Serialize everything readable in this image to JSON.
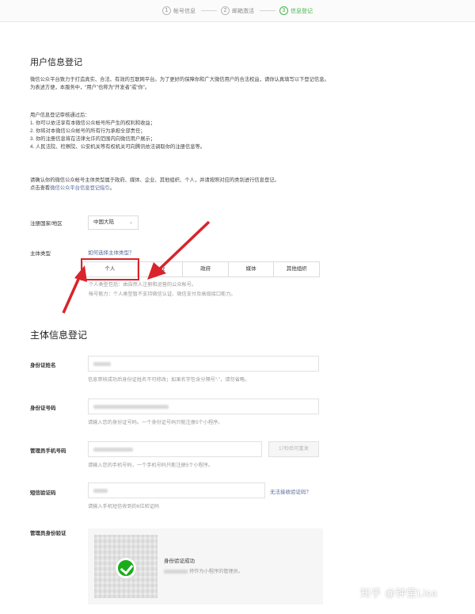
{
  "steps": [
    {
      "num": "1",
      "label": "帐号信息"
    },
    {
      "num": "2",
      "label": "邮箱激活"
    },
    {
      "num": "3",
      "label": "信息登记"
    }
  ],
  "page_title": "用户信息登记",
  "intro": {
    "line1": "微信公众平台致力于打造真实、合法、有效的互联网平台。为了更好的保障你和广大微信用户的合法权益，请你认真填写以下登记信息。",
    "line2": "为表述方便，本服务中，“用户”也称为“开发者”或“你”。"
  },
  "audit": {
    "heading": "用户信息登记审核通过后：",
    "items": [
      "1. 你可以依法享有本微信公众帐号所产生的权利和收益；",
      "2. 你将对本微信公众帐号的所有行为承担全部责任；",
      "3. 你的注册信息将在法律允许的范围内向微信用户展示；",
      "4. 人民法院、检察院、公安机关等有权机关可向腾讯依法调取你的注册信息等。"
    ]
  },
  "confirm": {
    "line1": "请确认你的微信公众帐号主体类型属于政府、媒体、企业、其他组织、个人，并请按照对应的类别进行信息登记。",
    "line2_prefix": "点击查看",
    "line2_link": "微信公众平台信息登记指引",
    "line2_suffix": "。"
  },
  "country": {
    "label": "注册国家/地区",
    "value": "中国大陆"
  },
  "subject": {
    "label": "主体类型",
    "help_link": "如何选择主体类型？",
    "tabs": [
      "个人",
      "企业",
      "政府",
      "媒体",
      "其他组织"
    ],
    "selected": "个人",
    "note1": "个人类型包括：由自然人注册和运营的公众帐号。",
    "note2": "帐号能力：个人类型暂不支持微信认证、微信支付及高级接口能力。"
  },
  "section_title": "主体信息登记",
  "fields": {
    "id_name": {
      "label": "身份证姓名",
      "hint": "信息审核成功后身份证姓名不可修改；如果名字包含分隔号“·”，请勿省略。"
    },
    "id_number": {
      "label": "身份证号码",
      "hint": "请输入您的身份证号码。一个身份证号码只能注册5个小程序。"
    },
    "phone": {
      "label": "管理员手机号码",
      "hint": "请输入您的手机号码，一个手机号码只能注册5个小程序。",
      "resend": "17秒后可重发"
    },
    "sms": {
      "label": "短信验证码",
      "hint": "请输入手机短信收到的6位验证码",
      "link": "无法接收验证码？"
    },
    "admin_verify": {
      "label": "管理员身份验证",
      "status": "身份验证成功",
      "desc": "将作为小程序的管理员。"
    }
  },
  "watermark": "知乎 @钟莹Lisa",
  "colors": {
    "accent": "#44b549",
    "link": "#576b95",
    "highlight": "#d8242a"
  }
}
